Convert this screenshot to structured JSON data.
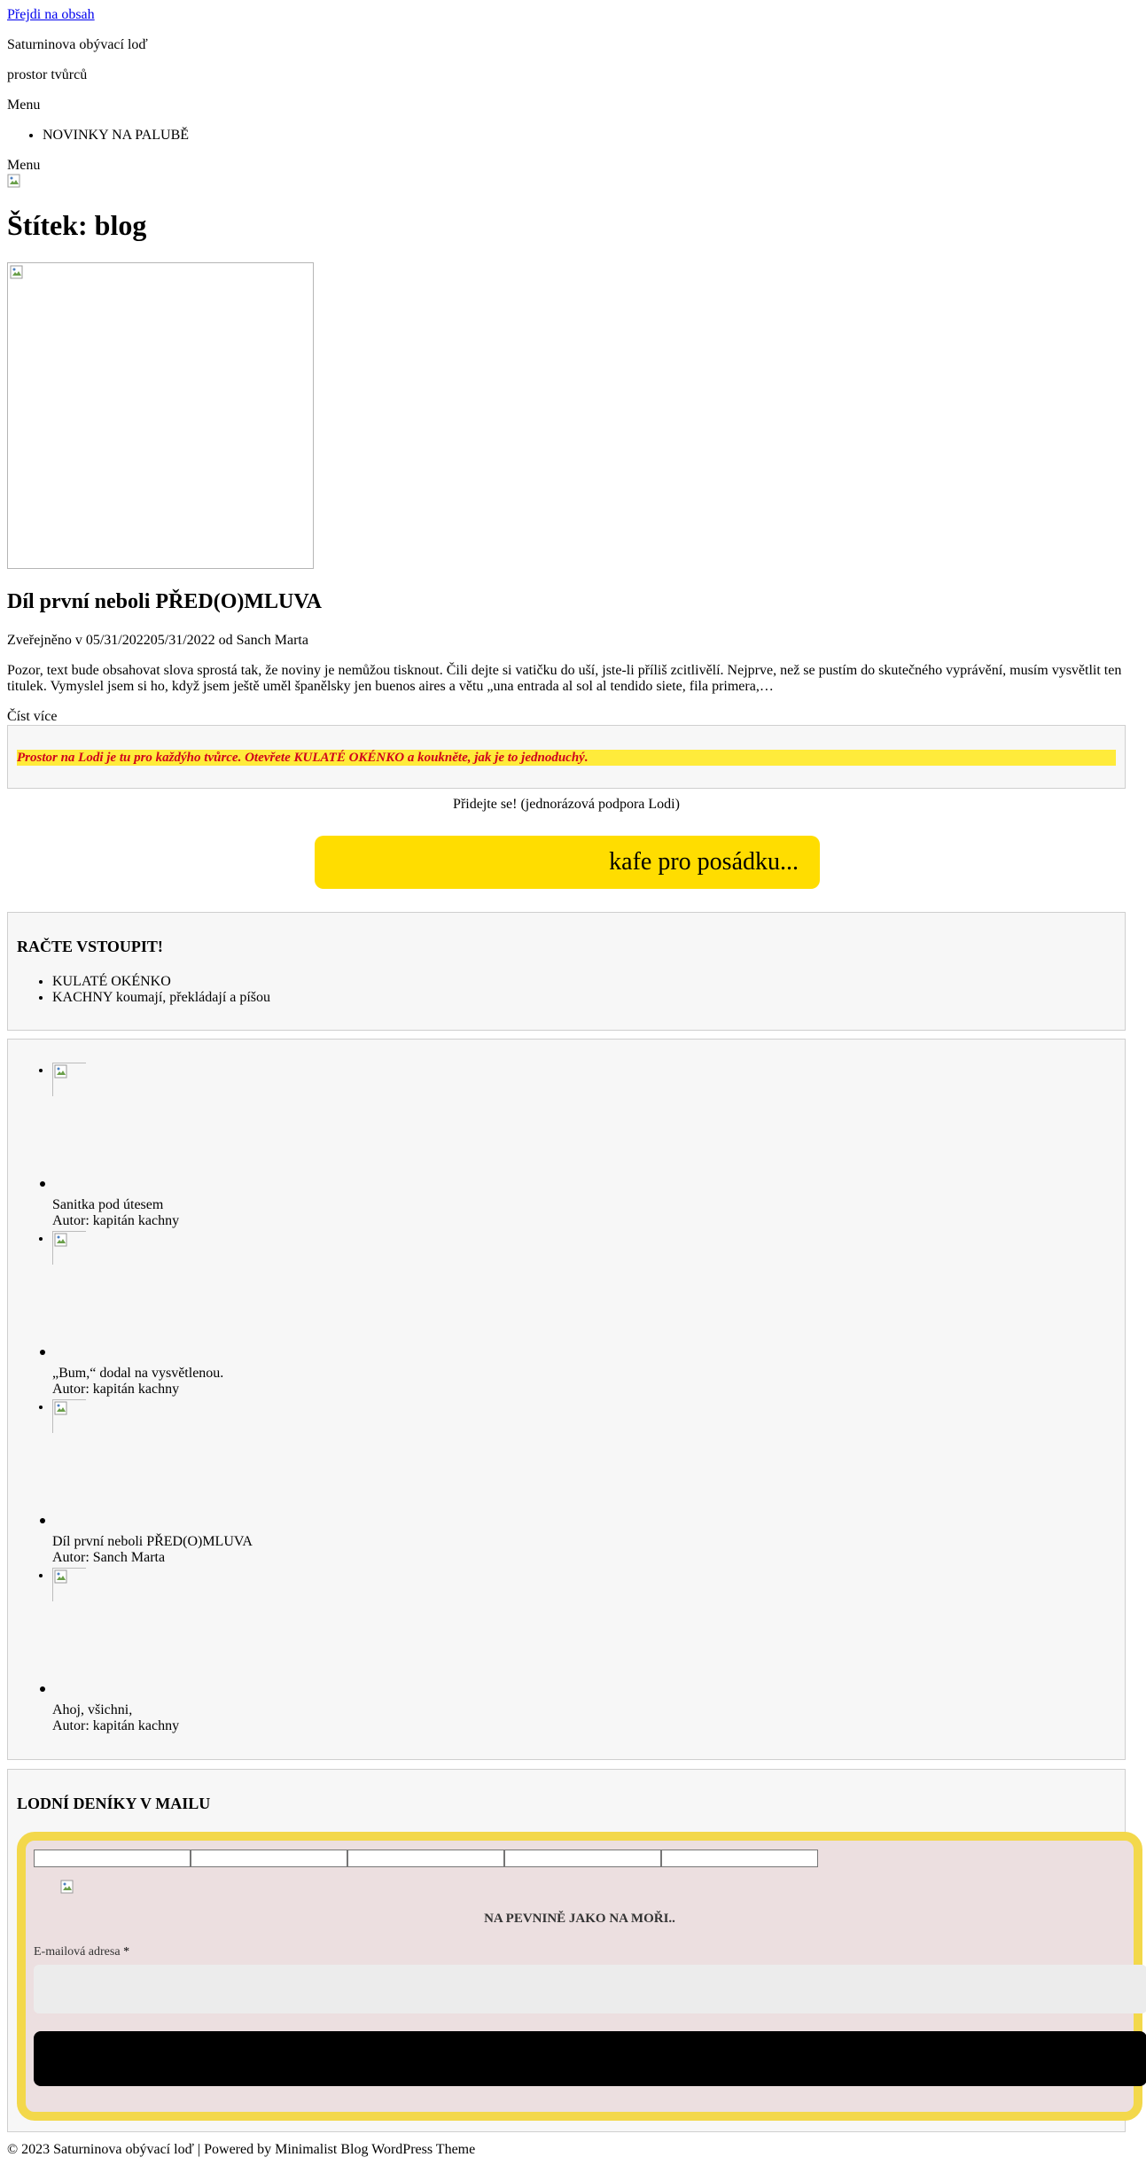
{
  "skip_link": "Přejdi na obsah",
  "site": {
    "title": "Saturninova obývací loď",
    "description": "prostor tvůrců"
  },
  "nav": {
    "menu_label": "Menu",
    "items": [
      {
        "label": "NOVINKY NA PALUBĚ"
      }
    ],
    "menu_label_2": "Menu"
  },
  "page_title": "Štítek: blog",
  "post": {
    "title": "Díl první neboli PŘED(O)MLUVA",
    "meta": "Zveřejněno v 05/31/202205/31/2022 od Sanch Marta",
    "excerpt": "Pozor, text bude obsahovat slova sprostá tak, že noviny je nemůžou tisknout. Čili dejte si vatičku do uší, jste-li příliš zcitlivělí. Nejprve, než se pustím do skutečného vyprávění, musím vysvětlit ten titulek. Vymyslel jsem si ho, když jsem ještě uměl španělsky jen buenos aires a větu „una entrada al sol al tendido siete, fila primera,…",
    "read_more": "Číst více"
  },
  "promo": {
    "text": "Prostor na Lodi je tu pro každýho tvůrce. Otevřete KULATÉ OKÉNKO a koukněte, jak je to jednoduchý."
  },
  "support": {
    "line": "Přidejte se! (jednorázová podpora Lodi)",
    "button": "kafe pro posádku..."
  },
  "enter_widget": {
    "title": "RAČTE VSTOUPIT!",
    "items": [
      {
        "label": "KULATÉ OKÉNKO"
      },
      {
        "label": "KACHNY koumají, překládají a píšou"
      }
    ]
  },
  "recent_posts": {
    "items": [
      {
        "title": "Sanitka pod útesem",
        "author": "Autor: kapitán kachny"
      },
      {
        "title": "„Bum,“ dodal na vysvětlenou.",
        "author": "Autor: kapitán kachny"
      },
      {
        "title": "Díl první neboli PŘED(O)MLUVA",
        "author": "Autor: Sanch Marta"
      },
      {
        "title": "Ahoj, všichni,",
        "author": "Autor: kapitán kachny"
      }
    ]
  },
  "newsletter": {
    "title": "LODNÍ DENÍKY V MAILU",
    "heading": "NA PEVNINĚ JAKO NA MOŘI..",
    "email_label": "E-mailová adresa",
    "required_mark": "*",
    "colors": {
      "border": "#f3d84b",
      "background": "#ecdfe0",
      "submit": "#000000"
    }
  },
  "footer": {
    "text": "© 2023 Saturninova obývací loď | Powered by Minimalist Blog WordPress Theme"
  },
  "colors": {
    "coffee_button": "#ffdd00",
    "promo_highlight": "#ffeb3b",
    "promo_text": "#d0021b",
    "widget_background": "#f7f7f7"
  },
  "icons": {
    "broken_image": "broken-image-icon"
  }
}
